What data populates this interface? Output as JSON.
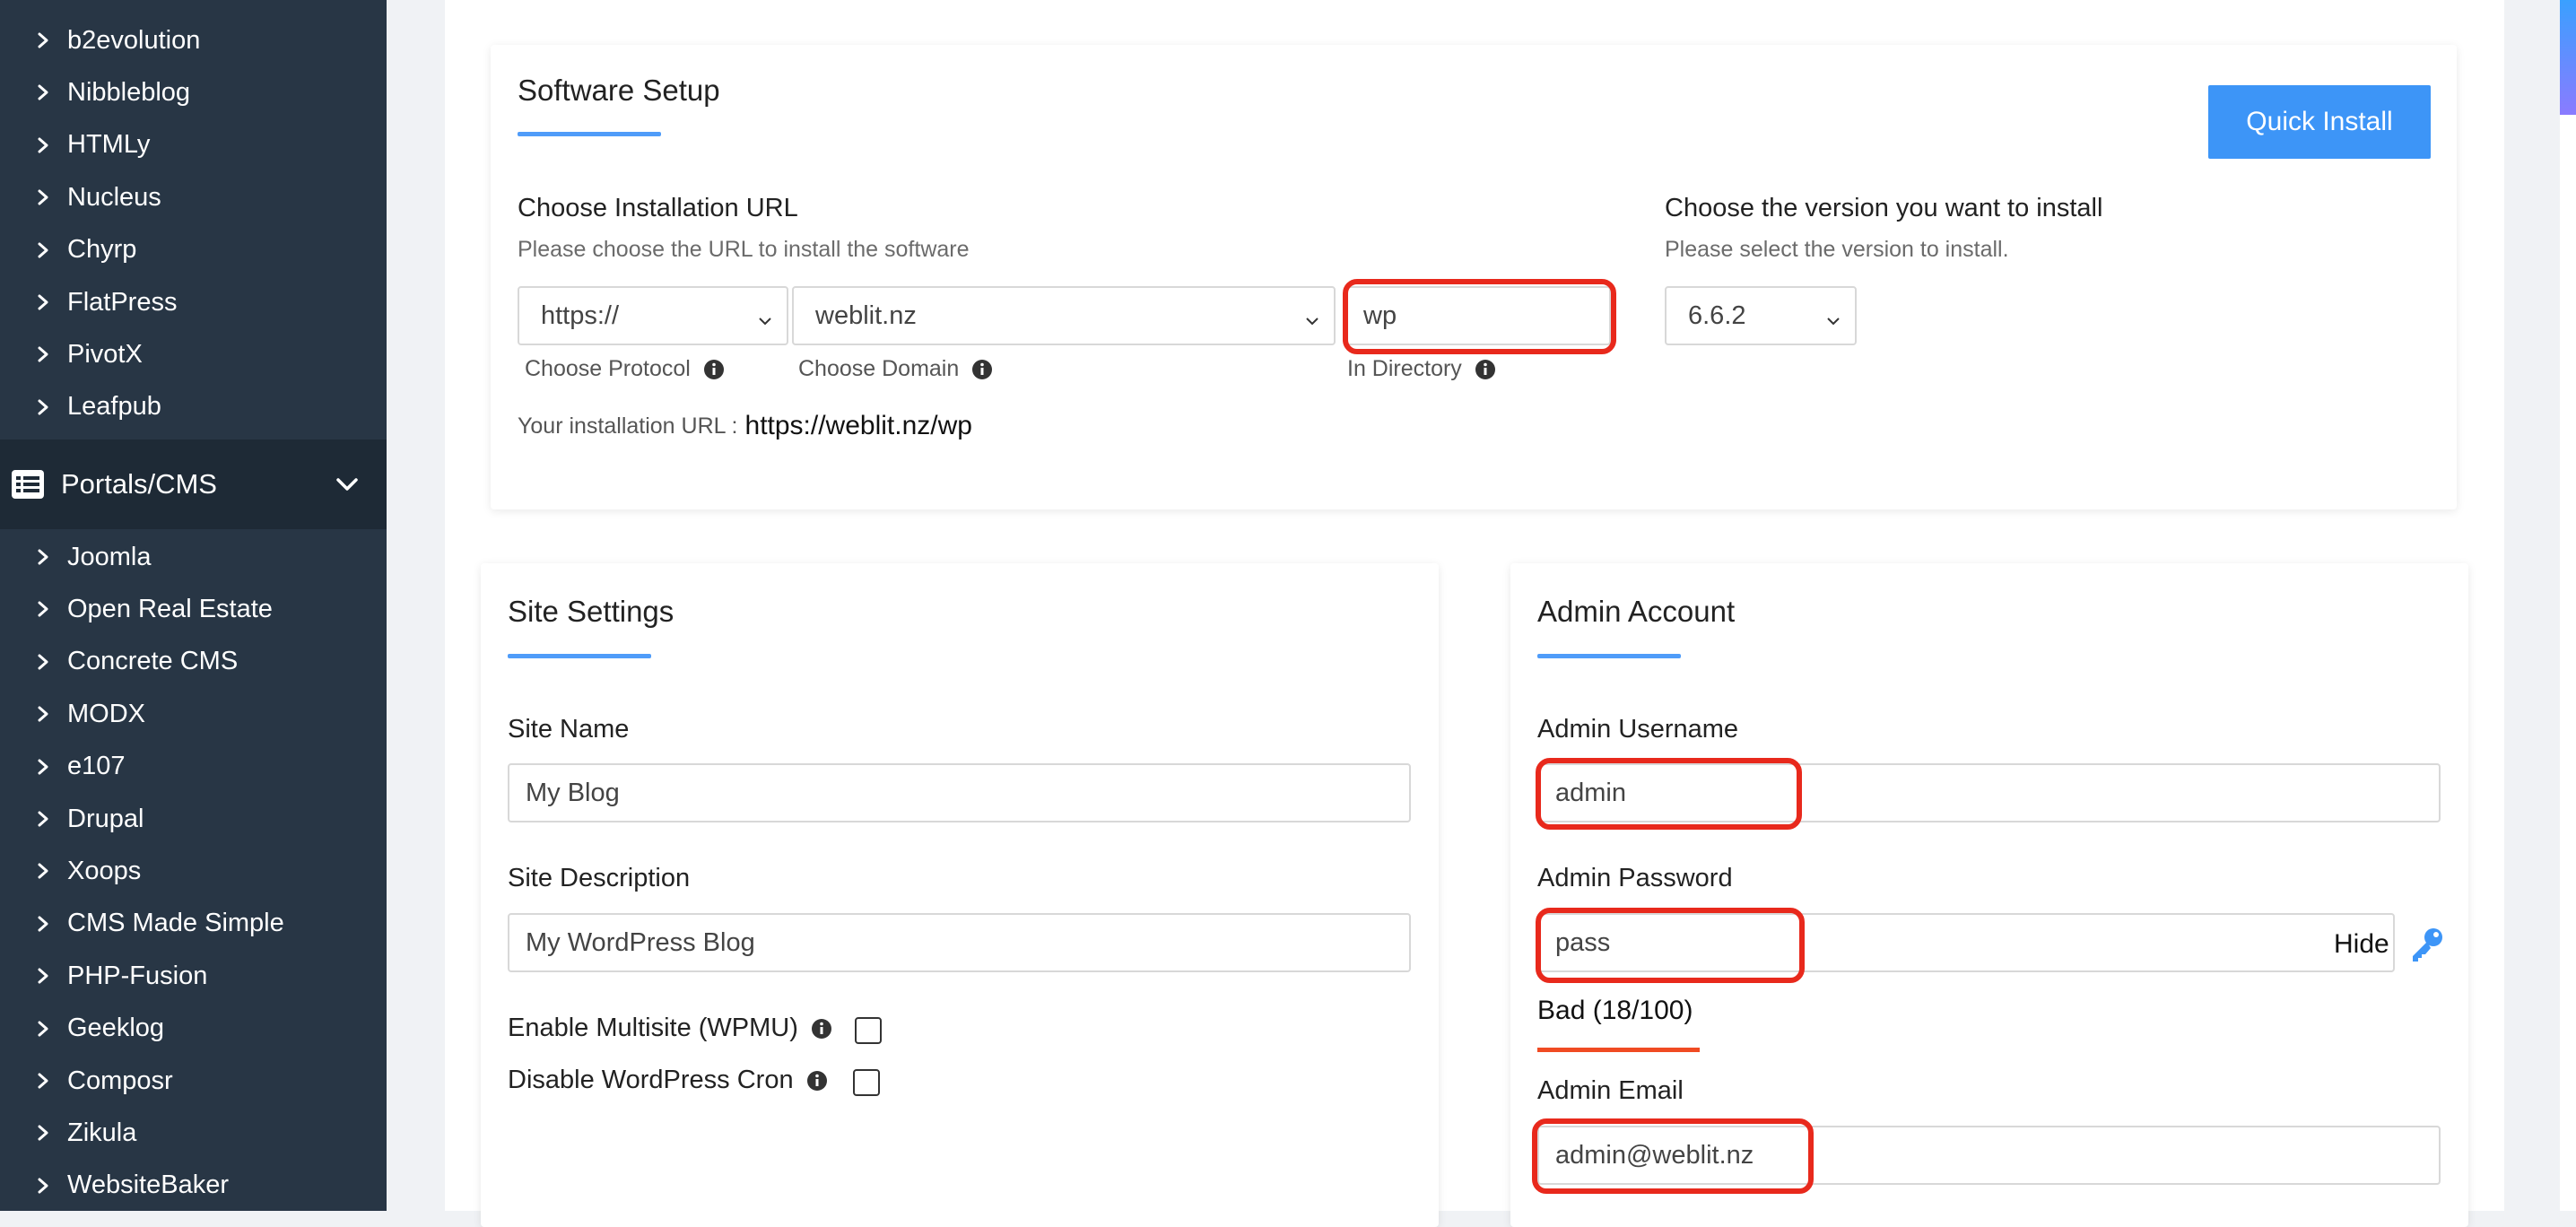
{
  "sidebar": {
    "items_top": [
      {
        "label": "b2evolution"
      },
      {
        "label": "Nibbleblog"
      },
      {
        "label": "HTMLy"
      },
      {
        "label": "Nucleus"
      },
      {
        "label": "Chyrp"
      },
      {
        "label": "FlatPress"
      },
      {
        "label": "PivotX"
      },
      {
        "label": "Leafpub"
      }
    ],
    "category": {
      "label": "Portals/CMS",
      "icon": "list-icon",
      "expanded": true
    },
    "items_cms": [
      {
        "label": "Joomla"
      },
      {
        "label": "Open Real Estate"
      },
      {
        "label": "Concrete CMS"
      },
      {
        "label": "MODX"
      },
      {
        "label": "e107"
      },
      {
        "label": "Drupal"
      },
      {
        "label": "Xoops"
      },
      {
        "label": "CMS Made Simple"
      },
      {
        "label": "PHP-Fusion"
      },
      {
        "label": "Geeklog"
      },
      {
        "label": "Composr"
      },
      {
        "label": "Zikula"
      },
      {
        "label": "WebsiteBaker"
      }
    ]
  },
  "software_setup": {
    "title": "Software Setup",
    "quick_install_label": "Quick Install",
    "install_url": {
      "heading": "Choose Installation URL",
      "subheading": "Please choose the URL to install the software",
      "protocol_value": "https://",
      "protocol_label": "Choose Protocol",
      "domain_value": "weblit.nz",
      "domain_label": "Choose Domain",
      "directory_value": "wp",
      "directory_label": "In Directory",
      "result_prefix": "Your installation URL :",
      "result_url": "https://weblit.nz/wp"
    },
    "version": {
      "heading": "Choose the version you want to install",
      "subheading": "Please select the version to install.",
      "value": "6.6.2"
    }
  },
  "site_settings": {
    "title": "Site Settings",
    "site_name_label": "Site Name",
    "site_name_value": "My Blog",
    "site_description_label": "Site Description",
    "site_description_value": "My WordPress Blog",
    "multisite_label": "Enable Multisite (WPMU)",
    "cron_label": "Disable WordPress Cron"
  },
  "admin_account": {
    "title": "Admin Account",
    "username_label": "Admin Username",
    "username_value": "admin",
    "password_label": "Admin Password",
    "password_value": "pass",
    "hide_label": "Hide",
    "strength_text": "Bad (18/100)",
    "strength_score": 18,
    "strength_color": "#f04b23",
    "email_label": "Admin Email",
    "email_value": "admin@weblit.nz"
  },
  "colors": {
    "accent": "#3d95f7",
    "sidebar_bg": "#283645",
    "highlight": "#e8291c"
  }
}
